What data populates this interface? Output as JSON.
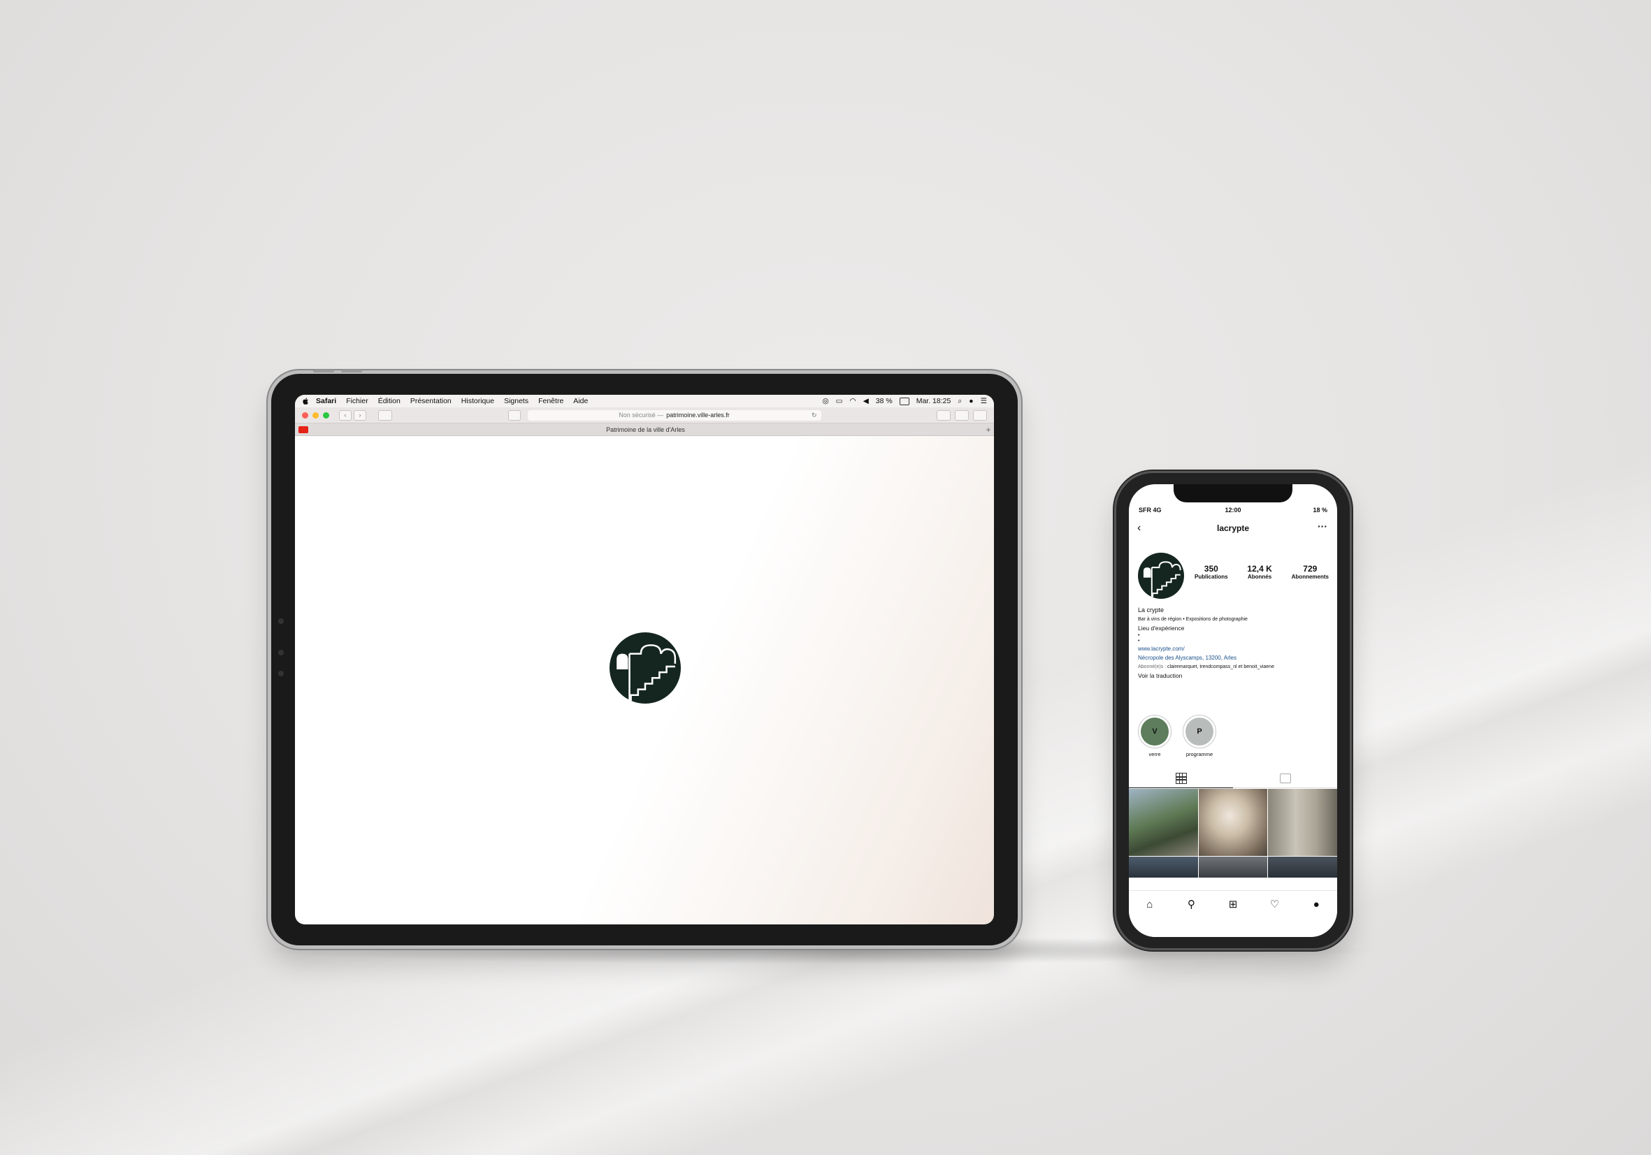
{
  "safari": {
    "menu": [
      "Safari",
      "Fichier",
      "Édition",
      "Présentation",
      "Historique",
      "Signets",
      "Fenêtre",
      "Aide"
    ],
    "status_right": {
      "battery": "38 %",
      "datetime": "Mar. 18:25"
    },
    "address": {
      "security": "Non sécurisé —",
      "url": "patrimoine.ville-arles.fr"
    },
    "tab_title": "Patrimoine de la ville d'Arles",
    "traffic_colors": [
      "#fe5f57",
      "#febc2e",
      "#28c840"
    ]
  },
  "instagram": {
    "status": {
      "carrier": "SFR 4G",
      "time": "12:00",
      "battery": "18 %"
    },
    "username": "lacrypte",
    "stats": [
      {
        "value": "350",
        "label": "Publications"
      },
      {
        "value": "12,4 K",
        "label": "Abonnés"
      },
      {
        "value": "729",
        "label": "Abonnements"
      }
    ],
    "bio": {
      "name": "La crypte",
      "line1": "Bar à vins de région • Expositions de photographie",
      "line2": "Lieu d'expérience",
      "bullet1": "•",
      "bullet2": "•",
      "website": "www.lacrypte.com/",
      "address": "Nécropole des Alyscamps, 13200, Arles",
      "followed_by_prefix": "Abonné(e)s :",
      "followed_by": "clairemarquet, trendcompass_nl et benoit_viaene",
      "translate": "Voir la traduction"
    },
    "highlights": [
      {
        "letter": "V",
        "label": "verre",
        "color": "#5d7d5c"
      },
      {
        "letter": "P",
        "label": "programme",
        "color": "#b8bcbb"
      }
    ]
  },
  "colors": {
    "logo_green": "#14261f"
  }
}
